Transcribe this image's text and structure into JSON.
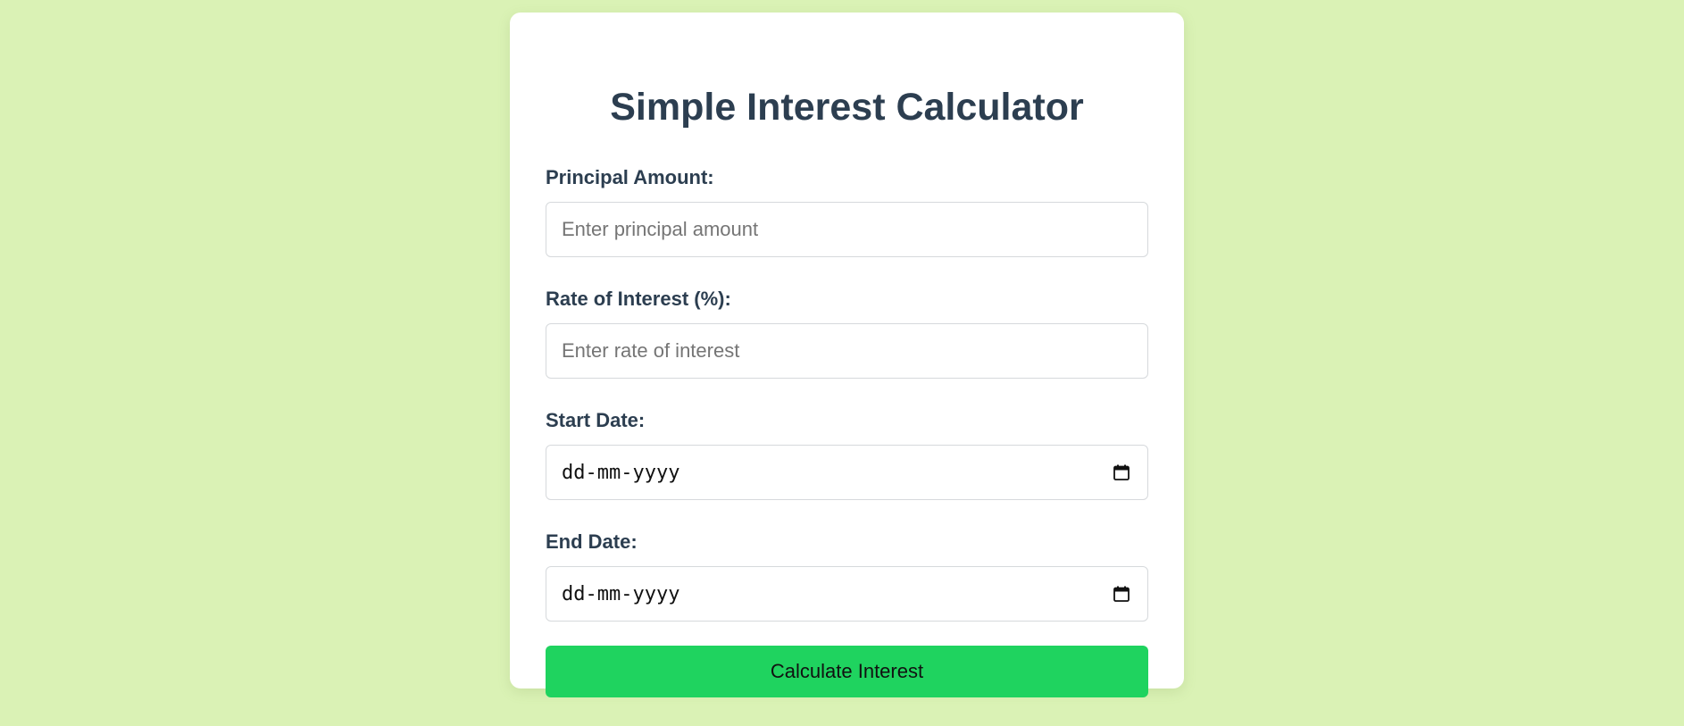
{
  "title": "Simple Interest Calculator",
  "fields": {
    "principal": {
      "label": "Principal Amount:",
      "placeholder": "Enter principal amount"
    },
    "rate": {
      "label": "Rate of Interest (%):",
      "placeholder": "Enter rate of interest"
    },
    "start_date": {
      "label": "Start Date:",
      "value": "dd-mm-yyyy",
      "icon": "calendar-icon"
    },
    "end_date": {
      "label": "End Date:",
      "value": "dd-mm-yyyy",
      "icon": "calendar-icon"
    }
  },
  "button": {
    "label": "Calculate Interest"
  },
  "colors": {
    "background": "#daf2b5",
    "card": "#ffffff",
    "heading": "#2c3e50",
    "button": "#1fd35f"
  }
}
